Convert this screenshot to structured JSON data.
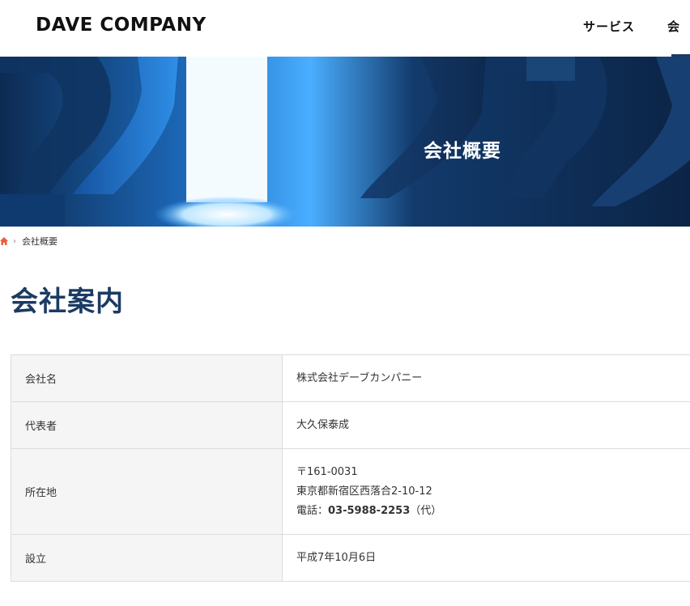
{
  "header": {
    "logo": "DAVE COMPANY",
    "nav": [
      {
        "label": "サービス"
      },
      {
        "label": "会"
      }
    ]
  },
  "hero": {
    "title": "会社概要"
  },
  "breadcrumb": {
    "current": "会社概要",
    "separator": "›"
  },
  "main": {
    "title": "会社案内",
    "rows": [
      {
        "label": "会社名",
        "value": "株式会社デーブカンパニー"
      },
      {
        "label": "代表者",
        "value": "大久保泰成"
      },
      {
        "label": "所在地",
        "postal": "〒161-0031",
        "address": "東京都新宿区西落合2-10-12",
        "phone_prefix": "電話：",
        "phone": "03-5988-2253",
        "phone_suffix": "（代）"
      },
      {
        "label": "設立",
        "value": "平成7年10月6日"
      }
    ]
  },
  "colors": {
    "brand_navy": "#1b3b63",
    "home_icon": "#e8603c"
  }
}
